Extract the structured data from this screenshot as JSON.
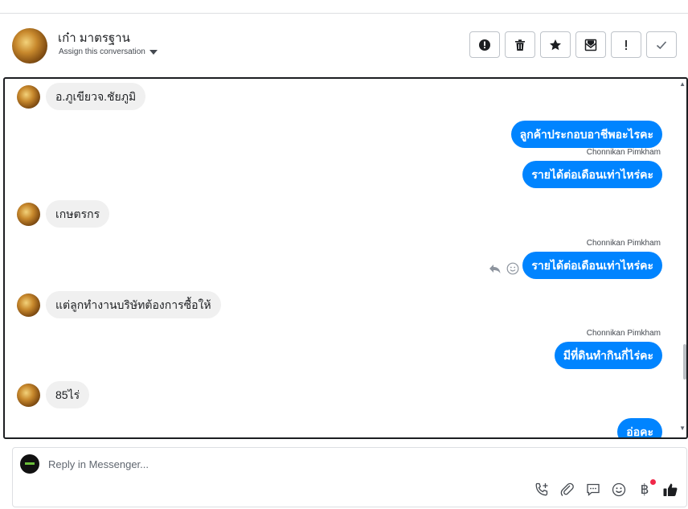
{
  "header": {
    "contact_name": "เก๋า มาตรฐาน",
    "assign_label": "Assign this conversation",
    "actions": [
      {
        "icon": "alert-circle-icon"
      },
      {
        "icon": "trash-icon"
      },
      {
        "icon": "star-icon"
      },
      {
        "icon": "mark-unread-icon"
      },
      {
        "icon": "exclamation-icon"
      },
      {
        "icon": "check-icon"
      }
    ]
  },
  "messages": [
    {
      "direction": "in",
      "text": "อ.ภูเขียวจ.ชัยภูมิ"
    },
    {
      "direction": "out",
      "text": "ลูกค้าประกอบอาชีพอะไรคะ"
    },
    {
      "direction": "out",
      "sender": "Chonnikan Pimkham",
      "text": "รายได้ต่อเดือนเท่าไหร่คะ"
    },
    {
      "direction": "in",
      "text": "เกษตรกร"
    },
    {
      "direction": "out",
      "sender": "Chonnikan Pimkham",
      "text": "รายได้ต่อเดือนเท่าไหร่คะ"
    },
    {
      "direction": "in",
      "text": "แต่ลูกทำงานบริษัทต้องการซื้อให้"
    },
    {
      "direction": "out",
      "sender": "Chonnikan Pimkham",
      "text": "มีที่ดินทำกินกี่ไร่คะ"
    },
    {
      "direction": "in",
      "text": "85ไร่"
    },
    {
      "direction": "out",
      "text": "อ่อคะ"
    }
  ],
  "reply": {
    "placeholder": "Reply in Messenger...",
    "tools": [
      "phone-plus-icon",
      "paperclip-icon",
      "saved-reply-icon",
      "emoji-icon",
      "baht-icon",
      "like-icon"
    ],
    "baht_symbol": "฿"
  },
  "colors": {
    "outgoing_bubble": "#0084ff",
    "incoming_bubble": "#f0f0f0",
    "notification_dot": "#f02849"
  }
}
